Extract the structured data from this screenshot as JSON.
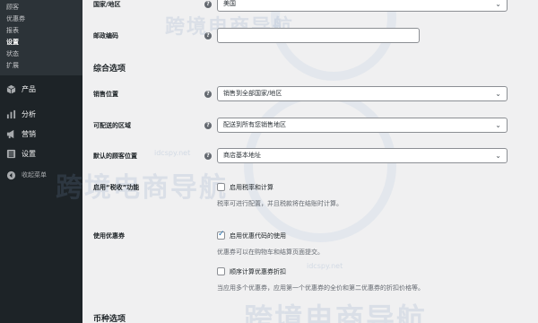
{
  "sidebar": {
    "submenu": [
      {
        "label": "顾客",
        "active": false
      },
      {
        "label": "优惠券",
        "active": false
      },
      {
        "label": "报表",
        "active": false
      },
      {
        "label": "设置",
        "active": true
      },
      {
        "label": "状态",
        "active": false
      },
      {
        "label": "扩展",
        "active": false
      }
    ],
    "menu": [
      {
        "label": "产品",
        "icon": "box-icon"
      },
      {
        "label": "分析",
        "icon": "bar-chart-icon"
      },
      {
        "label": "营销",
        "icon": "megaphone-icon"
      },
      {
        "label": "设置",
        "icon": "settings-icon"
      }
    ],
    "collapse_label": "收起菜单"
  },
  "form": {
    "country": {
      "label": "国家/地区",
      "value": "美国"
    },
    "postcode": {
      "label": "邮政编码",
      "value": ""
    },
    "general_section_title": "综合选项",
    "selling_location": {
      "label": "销售位置",
      "value": "销售到全部国家/地区"
    },
    "shipping_location": {
      "label": "可配送的区域",
      "value": "配送到所有您销售地区"
    },
    "default_customer_location": {
      "label": "默认的顾客位置",
      "value": "商店基本地址"
    },
    "taxes": {
      "label": "启用“税收”功能",
      "checkbox_label": "启用税率和计算",
      "checked": false,
      "description": "税率可进行配置，并且税款将在结账时计算。"
    },
    "coupons": {
      "label": "使用优惠券",
      "checkbox_label": "启用优惠代码的使用",
      "checked": true,
      "description": "优惠券可以在购物车和结算页面提交。",
      "sequential_label": "顺序计算优惠券折扣",
      "sequential_checked": false,
      "sequential_description": "当应用多个优惠券，应用第一个优惠券的全价和第二优惠券的折扣价格等。"
    },
    "currency_section_title": "币种选项"
  },
  "watermark": {
    "text": "跨境电商导航",
    "url": "idcspy.net"
  },
  "colors": {
    "sidebar_bg": "#1d2327",
    "submenu_bg": "#2c3338",
    "accent": "#2271b1"
  }
}
